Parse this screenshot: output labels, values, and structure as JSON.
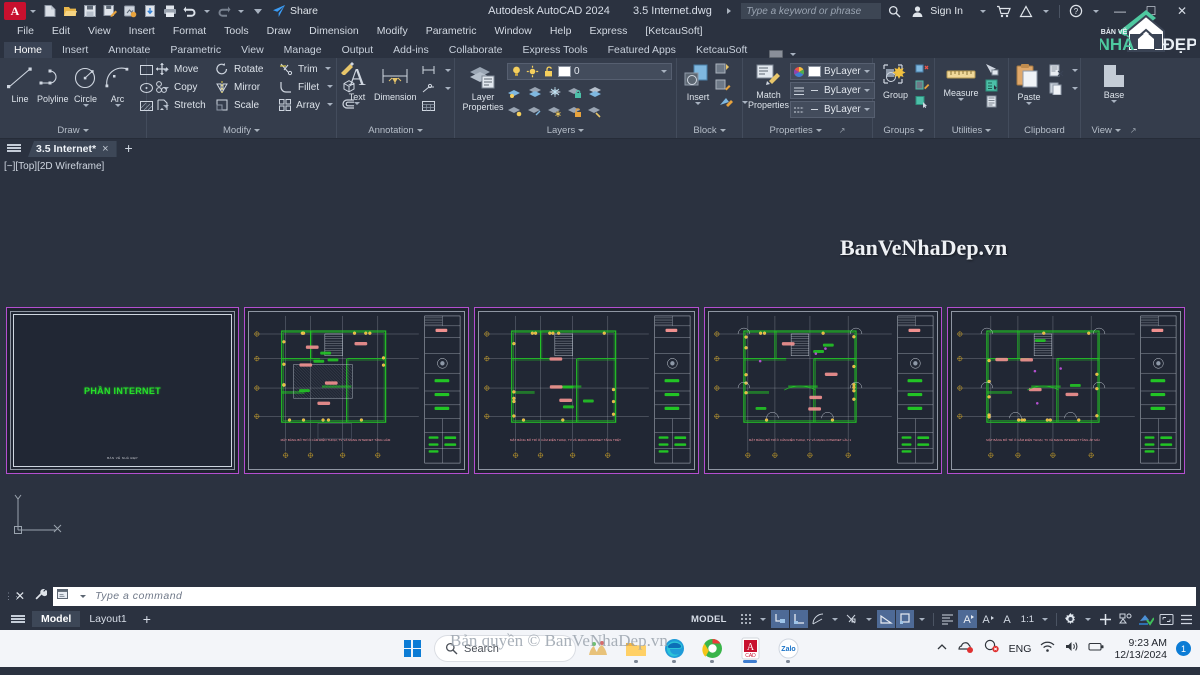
{
  "titlebar": {
    "app_icon": "autocad-a-icon",
    "quick_access": [
      "new-icon",
      "open-icon",
      "save-icon",
      "saveas-icon",
      "plot-preview-icon",
      "export-icon",
      "print-icon",
      "undo-icon",
      "redo-icon",
      "qat-more-icon"
    ],
    "share_label": "Share",
    "app_title": "Autodesk AutoCAD 2024",
    "file_name": "3.5 Internet.dwg",
    "search_placeholder": "Type a keyword or phrase",
    "sign_in_label": "Sign In",
    "window_controls": [
      "minimize",
      "restore",
      "close"
    ]
  },
  "menubar": {
    "items": [
      "File",
      "Edit",
      "View",
      "Insert",
      "Format",
      "Tools",
      "Draw",
      "Dimension",
      "Modify",
      "Parametric",
      "Window",
      "Help",
      "Express",
      "[KetcauSoft]"
    ]
  },
  "ribbon_tabs": {
    "items": [
      "Home",
      "Insert",
      "Annotate",
      "Parametric",
      "View",
      "Manage",
      "Output",
      "Add-ins",
      "Collaborate",
      "Express Tools",
      "Featured Apps",
      "KetcauSoft"
    ],
    "active": "Home"
  },
  "ribbon": {
    "panels": [
      {
        "title": "Draw",
        "big_buttons": [
          {
            "label": "Line",
            "icon": "line-icon"
          },
          {
            "label": "Polyline",
            "icon": "polyline-icon"
          },
          {
            "label": "Circle",
            "icon": "circle-icon"
          },
          {
            "label": "Arc",
            "icon": "arc-icon"
          }
        ],
        "small_icons": [
          "rectangle-icon",
          "ellipse-icon",
          "hatch-icon"
        ]
      },
      {
        "title": "Modify",
        "commands": [
          {
            "label": "Move",
            "icon": "move-icon"
          },
          {
            "label": "Rotate",
            "icon": "rotate-icon"
          },
          {
            "label": "Trim",
            "icon": "trim-icon"
          },
          {
            "label": "Copy",
            "icon": "copy-icon"
          },
          {
            "label": "Mirror",
            "icon": "mirror-icon"
          },
          {
            "label": "Fillet",
            "icon": "fillet-icon"
          },
          {
            "label": "Stretch",
            "icon": "stretch-icon"
          },
          {
            "label": "Scale",
            "icon": "scale-icon"
          },
          {
            "label": "Array",
            "icon": "array-icon"
          }
        ],
        "extra_icons": [
          "explode-icon",
          "3dsolid-icon",
          "offset-icon"
        ]
      },
      {
        "title": "Annotation",
        "big_buttons": [
          {
            "label": "Text",
            "icon": "text-icon"
          },
          {
            "label": "Dimension",
            "icon": "dimension-icon"
          }
        ],
        "small_icons": [
          "linear-dim-icon",
          "leader-icon",
          "table-icon"
        ]
      },
      {
        "title": "Layers",
        "big_buttons": [
          {
            "label": "Layer\nProperties",
            "icon": "layer-properties-icon"
          }
        ],
        "layer_combo": {
          "value": "0",
          "icons": [
            "bulb-on-icon",
            "sun-icon",
            "unlock-icon"
          ],
          "color": "#ffffff"
        },
        "tool_icons": [
          "layer-off-icon",
          "layer-isolate-icon",
          "layer-freeze-icon",
          "layer-lock-icon",
          "layer-make-current-icon",
          "layer-turn-on-icon",
          "layer-unisolate-icon",
          "layer-thaw-icon",
          "layer-unlock-icon",
          "layer-match-icon"
        ]
      },
      {
        "title": "Block",
        "big_buttons": [
          {
            "label": "Insert",
            "icon": "insert-block-icon"
          }
        ],
        "small_icons": [
          "create-block-icon",
          "edit-block-icon",
          "block-attribute-icon"
        ]
      },
      {
        "title": "Properties",
        "big_buttons": [
          {
            "label": "Match\nProperties",
            "icon": "match-properties-icon"
          }
        ],
        "combos": [
          {
            "label": "ByLayer",
            "icon": "color-wheel-icon",
            "swatch": "#ffffff"
          },
          {
            "label": "ByLayer",
            "icon": "lineweight-icon"
          },
          {
            "label": "ByLayer",
            "icon": "linetype-icon"
          }
        ]
      },
      {
        "title": "Groups",
        "big_buttons": [
          {
            "label": "Group",
            "icon": "group-icon"
          }
        ],
        "small_icons": [
          "ungroup-icon",
          "group-edit-icon",
          "group-selection-icon"
        ]
      },
      {
        "title": "Utilities",
        "big_buttons": [
          {
            "label": "Measure",
            "icon": "measure-ruler-icon"
          }
        ],
        "small_icons": [
          "quick-select-icon",
          "quick-calc-icon",
          "id-point-icon"
        ]
      },
      {
        "title": "Clipboard",
        "big_buttons": [
          {
            "label": "Paste",
            "icon": "paste-icon"
          }
        ],
        "small_icons": [
          "cut-icon",
          "copy-clip-icon"
        ]
      },
      {
        "title": "View",
        "big_buttons": [
          {
            "label": "Base",
            "icon": "base-view-icon"
          }
        ]
      }
    ]
  },
  "doc_tabs": {
    "menu_icon": "app-menu-icon",
    "tabs": [
      {
        "label": "3.5 Internet*",
        "close": "×",
        "active": true
      }
    ],
    "new_tab": "+"
  },
  "canvas": {
    "viewport_label": "[−][Top][2D Wireframe]",
    "ucs": {
      "x_label": "X",
      "y_label": "Y"
    },
    "sheets": [
      {
        "id": "sheet-cover",
        "title": "PHẦN INTERNET",
        "subtitle": "BẢN VẼ NHÀ ĐẸP",
        "kind": "cover"
      },
      {
        "id": "sheet-basement",
        "caption": "MẶT BẰNG BỐ TRÍ Ổ CẮM ĐIỆN THOẠI, TV VÀ MẠNG INTERNET TẦNG HẦM",
        "kind": "plan"
      },
      {
        "id": "sheet-ground",
        "caption": "MẶT BẰNG BỐ TRÍ Ổ CẮM ĐIỆN THOẠI, TV VÀ MẠNG INTERNET TẦNG TRỆT",
        "kind": "plan"
      },
      {
        "id": "sheet-floor1",
        "caption": "MẶT BẰNG BỐ TRÍ Ổ CẮM ĐIỆN THOẠI, TV VÀ MẠNG INTERNET LẦU 1",
        "kind": "plan"
      },
      {
        "id": "sheet-roof",
        "caption": "MẶT BẰNG BỐ TRÍ Ổ CẮM ĐIỆN THOẠI, TV VÀ MẠNG INTERNET TẦNG ÁP MÁI",
        "kind": "plan"
      }
    ]
  },
  "command_line": {
    "placeholder": "Type a command",
    "close_icon": "close-icon",
    "customize_icon": "wrench-icon",
    "history_icon": "command-history-icon"
  },
  "status_bar": {
    "menu_icon": "layout-menu-icon",
    "tabs": [
      {
        "label": "Model",
        "active": true
      },
      {
        "label": "Layout1",
        "active": false
      }
    ],
    "new_layout": "+",
    "space_label": "MODEL",
    "scale_label": "1:1",
    "toggles": [
      "grid-icon",
      "snap-icon",
      "ortho-icon",
      "polar-icon",
      "osnap-icon",
      "otrack-icon",
      "lineweight-icon",
      "transparency-icon",
      "selection-cycling-icon",
      "annotation-visibility-icon",
      "annotation-scale-icon",
      "workspace-gear-icon",
      "customization-plus-icon",
      "isolate-objects-icon",
      "hardware-accel-icon",
      "clean-screen-icon",
      "status-menu-icon"
    ]
  },
  "taskbar": {
    "start_icon": "windows-start-icon",
    "search_placeholder": "Search",
    "apps": [
      "widgets-icon",
      "file-explorer-icon",
      "edge-icon",
      "chrome-beta-icon",
      "autocad-icon",
      "zalo-icon"
    ],
    "tray": {
      "overflow_icon": "chevron-up-icon",
      "icons": [
        "onedrive-sync-error-icon",
        "security-alert-icon"
      ],
      "language": "ENG",
      "network_icon": "wifi-icon",
      "volume_icon": "speaker-icon",
      "battery_icon": "battery-icon",
      "time": "9:23 AM",
      "date": "12/13/2024",
      "notification_count": "1"
    }
  },
  "watermarks": {
    "logo_line1": "BẢN VẼ",
    "logo_line2": "NHÀ",
    "logo_line3": "ĐẸP",
    "center_text": "BanVeNhaDep.vn",
    "bottom_text": "Bản quyền © BanVeNhaDep.vn"
  },
  "colors": {
    "accent": "#4e6a96",
    "ribbon_bg": "#353d4c",
    "chrome_bg": "#2b3240",
    "canvas_bg": "#2b3240",
    "sheet_border": "#b44fd0",
    "plan_green": "#22c425",
    "plan_title": "#ff9aa8"
  }
}
